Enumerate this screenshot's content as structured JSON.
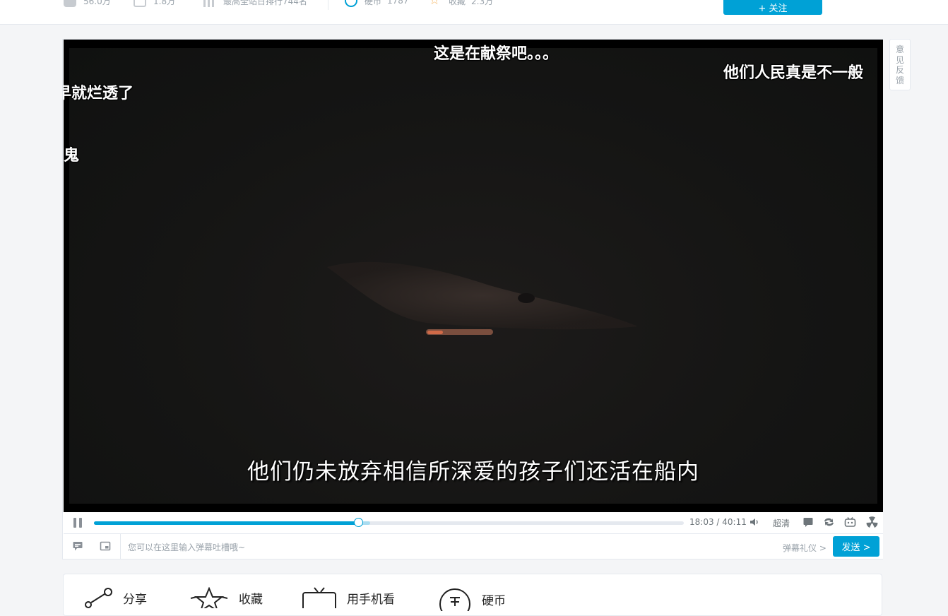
{
  "stats": {
    "plays": "56.0万",
    "danmaku": "1.8万",
    "rank": "最高全站日排行744名",
    "coins_label": "硬币",
    "coins": "1787",
    "favorites_label": "收藏",
    "favorites": "2.3万"
  },
  "follow_button": "+ 关注",
  "feedback": "意见反馈",
  "video": {
    "subtitle": "他们仍未放弃相信所深爱的孩子们还活在船内",
    "danmaku": [
      "这是在献祭吧。。。",
      "他们人民真是不一般",
      "早就烂透了",
      "鬼"
    ]
  },
  "controls": {
    "progress": 0.449,
    "buffered": 0.468,
    "current_time": "18:03",
    "total_time": "40:11",
    "quality": "超清"
  },
  "sendbar": {
    "placeholder": "您可以在这里输入弹幕吐槽哦~",
    "etiquette": "弹幕礼仪 >",
    "send": "发送 >"
  },
  "actions": {
    "share": "分享",
    "favorite": "收藏",
    "mobile": "用手机看",
    "coin": "硬币"
  },
  "colors": {
    "accent": "#00a1d6"
  }
}
